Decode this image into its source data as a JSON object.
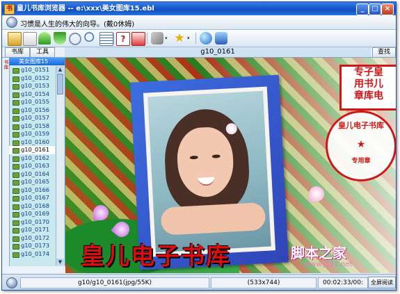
{
  "window": {
    "title": "皇儿书库浏览器 -- e:\\xxx\\美女图库15.ebl",
    "app_icon": "book-app-icon",
    "controls": [
      "minimize-icon",
      "maximize-icon",
      "close-icon"
    ]
  },
  "prompt_bar": {
    "text": "习惯是人生的伟大的向导。(戴0休姆)"
  },
  "toolbar": {
    "icons": [
      "open-book-icon",
      "file-icon",
      "up-arrow-icon",
      "down-arrow-icon",
      "circle-back-icon",
      "zoom-icon",
      "list-icon",
      "help-icon",
      "info-icon",
      "tools-icon",
      "dropdown-icon",
      "favorites-star-icon",
      "dropdown-icon",
      "refresh-globe-icon",
      "globe-book-icon"
    ]
  },
  "tabs": {
    "library_label": "书库",
    "tools_label": "工具",
    "current_title": "g10_0161",
    "search_label": "查找"
  },
  "sidebar": {
    "vertical_tab": "书库",
    "header": "美女图库15",
    "selected": "g10_0161",
    "items": [
      "g10_0151",
      "g10_0152",
      "g10_0153",
      "g10_0154",
      "g10_0155",
      "g10_0156",
      "g10_0157",
      "g10_0158",
      "g10_0159",
      "g10_0160",
      "g10_0161",
      "g10_0162",
      "g10_0163",
      "g10_0164",
      "g10_0165",
      "g10_0166",
      "g10_0167",
      "g10_0168",
      "g10_0169",
      "g10_0170",
      "g10_0171",
      "g10_0172",
      "g10_0173",
      "g10_0174"
    ]
  },
  "viewer": {
    "stamp_square_lines": [
      "专子皇",
      "用书儿",
      "章库电"
    ],
    "stamp_round_arc": "皇儿电子书库",
    "stamp_round_star": "★",
    "stamp_round_label": "专用章",
    "big_title": "皇儿电子书库",
    "watermark": "脚本之家",
    "watermark_url": "www.jb51.net"
  },
  "status": {
    "file": "g10/g10_0161(jpg/55K)",
    "dimensions": "(533x744)",
    "time": "00:02:33/00:",
    "fullscreen_label": "全屏阅读"
  },
  "colors": {
    "titlebar": "#1659cf",
    "stamp_red": "#d01616",
    "selected_row": "#ffffff"
  }
}
